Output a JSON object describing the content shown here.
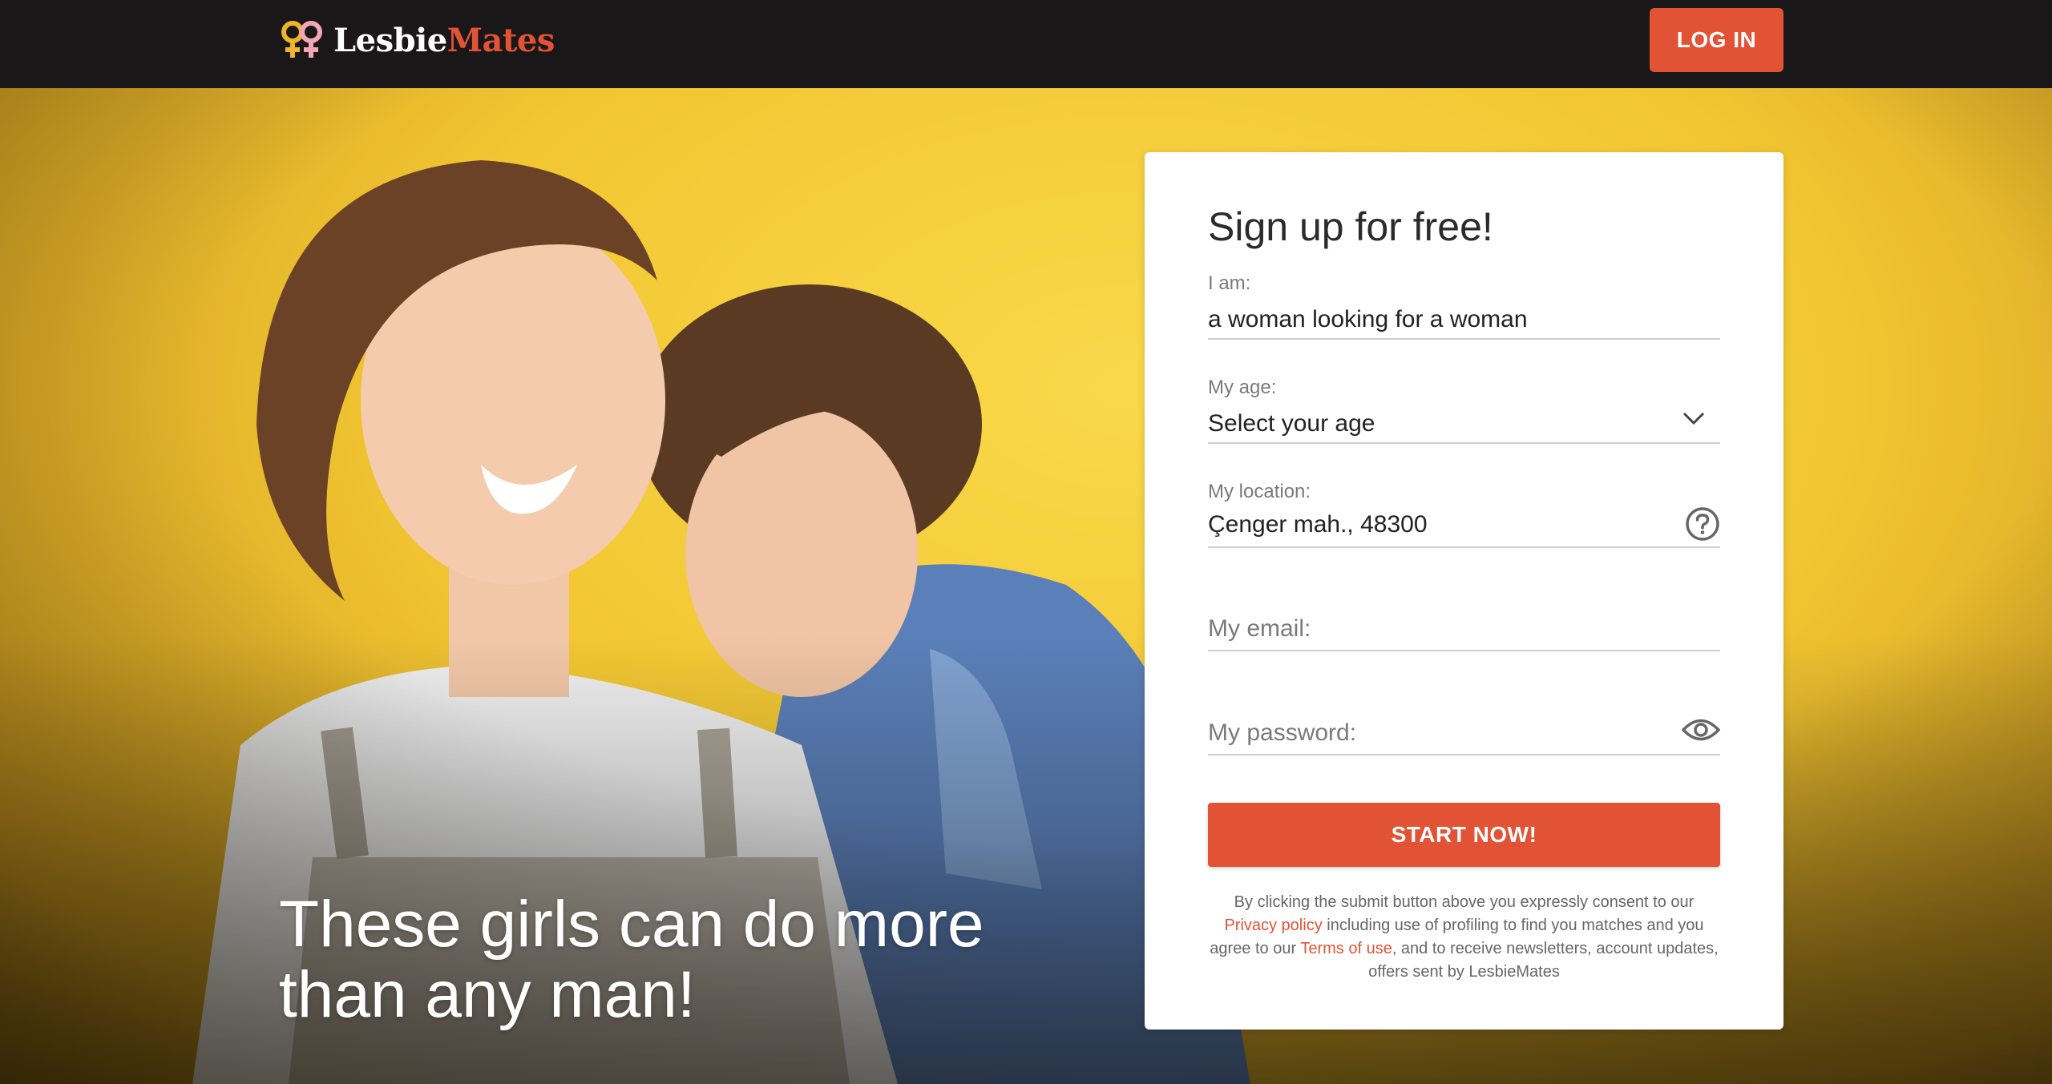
{
  "brand": {
    "name_part1": "Lesbie",
    "name_part2": "Mates",
    "logo_colors": [
      "#f0b429",
      "#f2a7b5"
    ]
  },
  "header": {
    "login_label": "LOG IN"
  },
  "hero": {
    "headline": "These girls can do more than any man!"
  },
  "signup": {
    "title": "Sign up for free!",
    "i_am": {
      "label": "I am:",
      "value": "a woman looking for a woman"
    },
    "age": {
      "label": "My age:",
      "value": "Select your age",
      "icon": "chevron-down-icon"
    },
    "location": {
      "label": "My location:",
      "value": "Çenger mah., 48300",
      "icon": "help-circle-icon"
    },
    "email": {
      "placeholder": "My email:"
    },
    "password": {
      "placeholder": "My password:",
      "icon": "eye-icon"
    },
    "submit_label": "START NOW!",
    "consent": {
      "text_1": "By clicking the submit button above you expressly consent to our ",
      "privacy_link": "Privacy policy",
      "text_2": " including use of profiling to find you matches and you agree to our ",
      "terms_link": "Terms of use",
      "text_3": ", and to receive newsletters, account updates, offers sent by LesbieMates"
    }
  },
  "colors": {
    "accent": "#e25336",
    "header_bg": "#1a1718",
    "hero_bg": "#f2c632"
  }
}
